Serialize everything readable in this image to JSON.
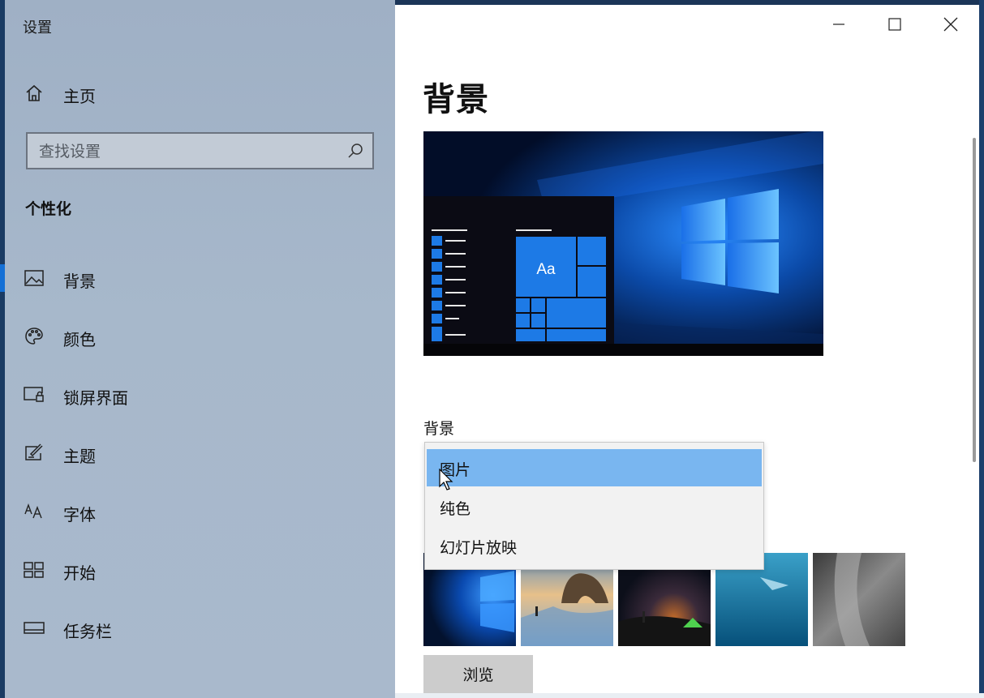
{
  "window": {
    "title": "设置",
    "controls": [
      "minimize-icon",
      "maximize-icon",
      "close-icon"
    ]
  },
  "sidebar": {
    "home_label": "主页",
    "search": {
      "placeholder": "查找设置",
      "value": ""
    },
    "section_title": "个性化",
    "items": [
      {
        "label": "背景",
        "icon": "image-icon",
        "active": true
      },
      {
        "label": "颜色",
        "icon": "palette-icon",
        "active": false
      },
      {
        "label": "锁屏界面",
        "icon": "lock-screen-icon",
        "active": false
      },
      {
        "label": "主题",
        "icon": "theme-brush-icon",
        "active": false
      },
      {
        "label": "字体",
        "icon": "font-icon",
        "active": false
      },
      {
        "label": "开始",
        "icon": "start-tiles-icon",
        "active": false
      },
      {
        "label": "任务栏",
        "icon": "taskbar-icon",
        "active": false
      }
    ]
  },
  "main": {
    "page_title": "背景",
    "preview": {
      "tile_label": "Aa"
    },
    "background_label": "背景",
    "dropdown": {
      "options": [
        "图片",
        "纯色",
        "幻灯片放映"
      ],
      "selected_index": 0
    },
    "thumbnails": [
      "windows-blue-logo-wallpaper",
      "beach-rock-arch-wallpaper",
      "night-sky-tent-wallpaper",
      "underwater-swimmer-wallpaper",
      "rock-cliff-climber-wallpaper"
    ],
    "browse_label": "浏览"
  },
  "colors": {
    "accent": "#1470d6",
    "selected_option": "#79b6f0",
    "sidebar_bg": "#a7b8cb"
  }
}
